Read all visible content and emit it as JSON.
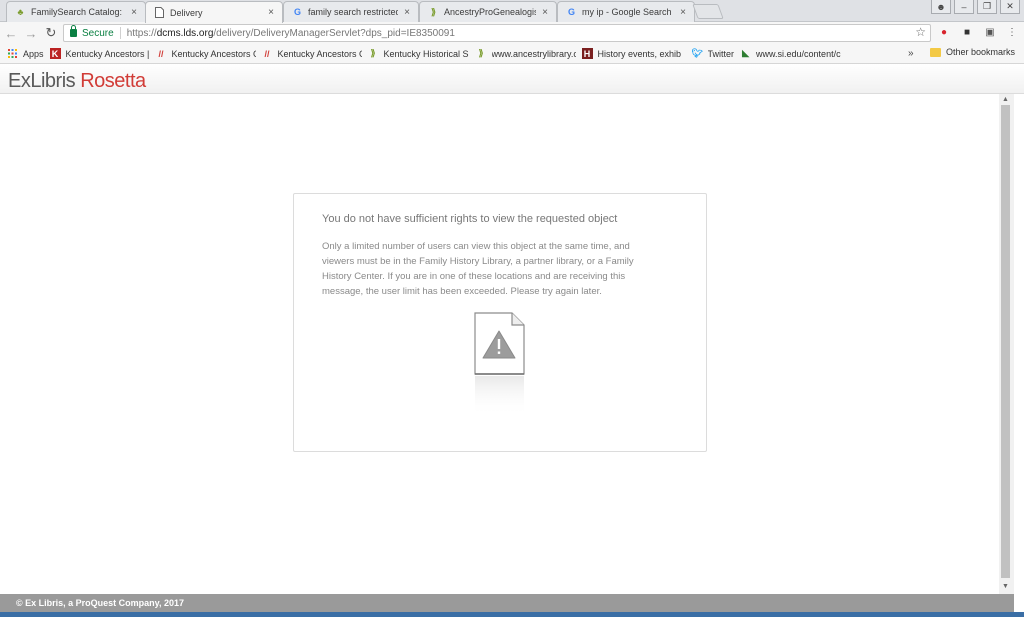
{
  "browser": {
    "tabs": [
      {
        "title": "FamilySearch Catalog: De",
        "icon": "tree-icon",
        "active": false
      },
      {
        "title": "Delivery",
        "icon": "page-icon",
        "active": true
      },
      {
        "title": "family search restricted n",
        "icon": "google-icon",
        "active": false
      },
      {
        "title": "AncestryProGenealogists",
        "icon": "leaf-icon",
        "active": false
      },
      {
        "title": "my ip - Google Search",
        "icon": "google-icon",
        "active": false
      }
    ],
    "tab_close": "×",
    "address": {
      "secure_label": "Secure",
      "url_prefix": "https://",
      "url_host": "dcms.lds.org",
      "url_path": "/delivery/DeliveryManagerServlet?dps_pid=IE8350091"
    },
    "bookmarks": [
      {
        "label": "Apps",
        "icon": "apps-grid-icon"
      },
      {
        "label": "Kentucky Ancestors |",
        "icon": "ky-icon"
      },
      {
        "label": "Kentucky Ancestors C",
        "icon": "slash-icon"
      },
      {
        "label": "Kentucky Ancestors C",
        "icon": "slash-icon"
      },
      {
        "label": "Kentucky Historical S",
        "icon": "leaf-icon"
      },
      {
        "label": "www.ancestrylibrary.c",
        "icon": "leaf-icon"
      },
      {
        "label": "History events, exhib",
        "icon": "h-icon"
      },
      {
        "label": "Twitter",
        "icon": "twitter-icon"
      },
      {
        "label": "www.si.edu/content/c",
        "icon": "si-icon"
      }
    ],
    "bookmarks_more": "»",
    "other_bookmarks": "Other bookmarks"
  },
  "header": {
    "logo_ex": "ExLibris",
    "logo_rosetta": "Rosetta"
  },
  "message": {
    "title": "You do not have sufficient rights to view the requested object",
    "body": "Only a limited number of users can view this object at the same time, and viewers must be in the Family History Library, a partner library, or a Family History Center. If you are in one of these locations and are receiving this message, the user limit has been exceeded. Please try again later."
  },
  "footer": {
    "text": "© Ex Libris, a ProQuest Company, 2017"
  },
  "colors": {
    "brand_red": "#d13c37",
    "secure_green": "#0b8043",
    "footer_gray": "#9a9a9a"
  }
}
